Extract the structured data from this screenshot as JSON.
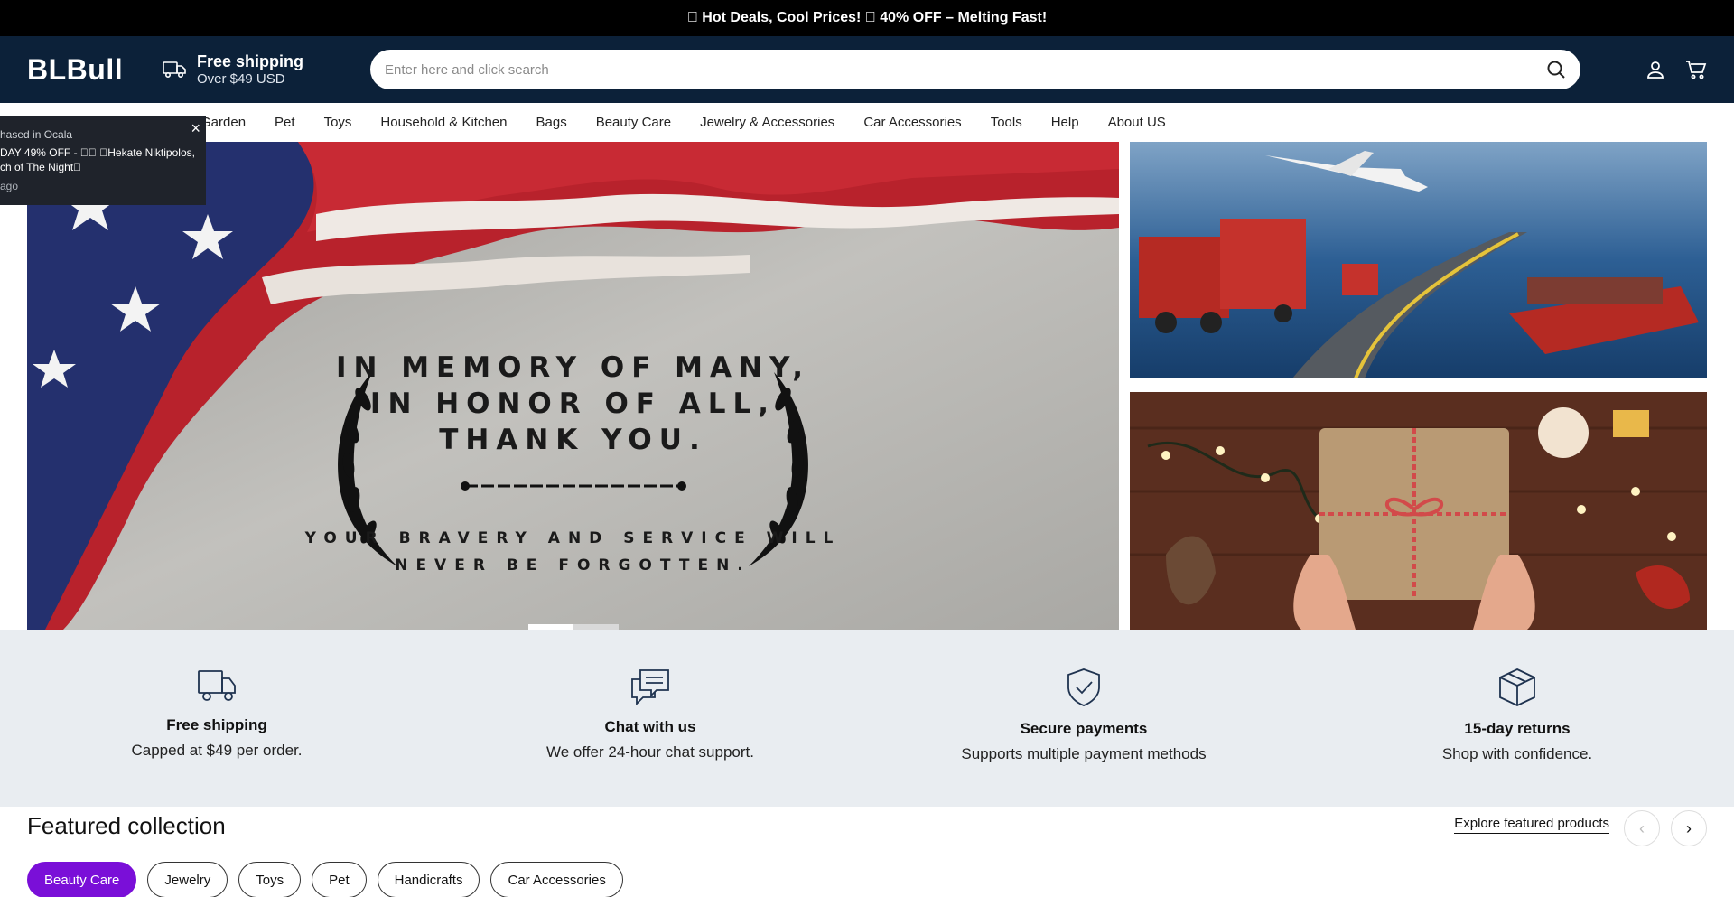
{
  "announcement": "\u0000 Hot Deals, Cool Prices! \u0000 40% OFF – Melting Fast!",
  "header": {
    "logo": "BLBull",
    "shipping_title": "Free shipping",
    "shipping_sub": "Over $49 USD",
    "search_placeholder": "Enter here and click search"
  },
  "nav": {
    "items": [
      "Garden",
      "Pet",
      "Toys",
      "Household & Kitchen",
      "Bags",
      "Beauty Care",
      "Jewelry & Accessories",
      "Car Accessories",
      "Tools",
      "Help",
      "About US"
    ]
  },
  "toast": {
    "line1": "hased in Ocala",
    "line2a": "DAY 49% OFF - \u0000\u0000 \u0000Hekate Niktipolos,",
    "line2b": "ch of The Night\u0000",
    "line3": "ago"
  },
  "hero": {
    "memorial_line1": "IN MEMORY OF MANY,",
    "memorial_line2": "IN HONOR OF ALL,",
    "memorial_line3": "THANK YOU.",
    "memorial_sub1": "YOUR BRAVERY AND SERVICE WILL",
    "memorial_sub2": "NEVER BE FORGOTTEN."
  },
  "features": [
    {
      "icon": "truck-icon",
      "title": "Free shipping",
      "desc": "Capped at $49 per order."
    },
    {
      "icon": "chat-icon",
      "title": "Chat with us",
      "desc": "We offer 24-hour chat support."
    },
    {
      "icon": "shield-check-icon",
      "title": "Secure payments",
      "desc": "Supports multiple payment methods"
    },
    {
      "icon": "box-icon",
      "title": "15-day returns",
      "desc": "Shop with confidence."
    }
  ],
  "featured": {
    "title": "Featured collection",
    "explore": "Explore featured products",
    "tabs": [
      "Beauty Care",
      "Jewelry",
      "Toys",
      "Pet",
      "Handicrafts",
      "Car Accessories"
    ],
    "active_tab": "Beauty Care"
  },
  "colors": {
    "header_bg": "#0c2139",
    "accent": "#7a0fd8",
    "features_bg": "#e9edf1"
  }
}
